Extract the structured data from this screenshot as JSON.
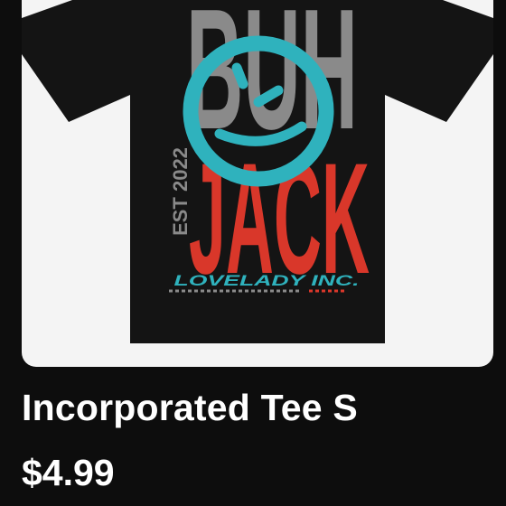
{
  "product": {
    "title": "Incorporated Tee S",
    "price": "$4.99",
    "image": {
      "icon": "tshirt-graphic",
      "print": {
        "top_word": "BUH",
        "bottom_word": "JACK",
        "est_text": "EST 2022",
        "brand_line": "LOVELADY INC."
      },
      "colors": {
        "shirt": "#141414",
        "grey": "#8a8a8a",
        "red": "#d9372a",
        "teal": "#2fb2bd",
        "background": "#f4f4f4"
      }
    }
  }
}
